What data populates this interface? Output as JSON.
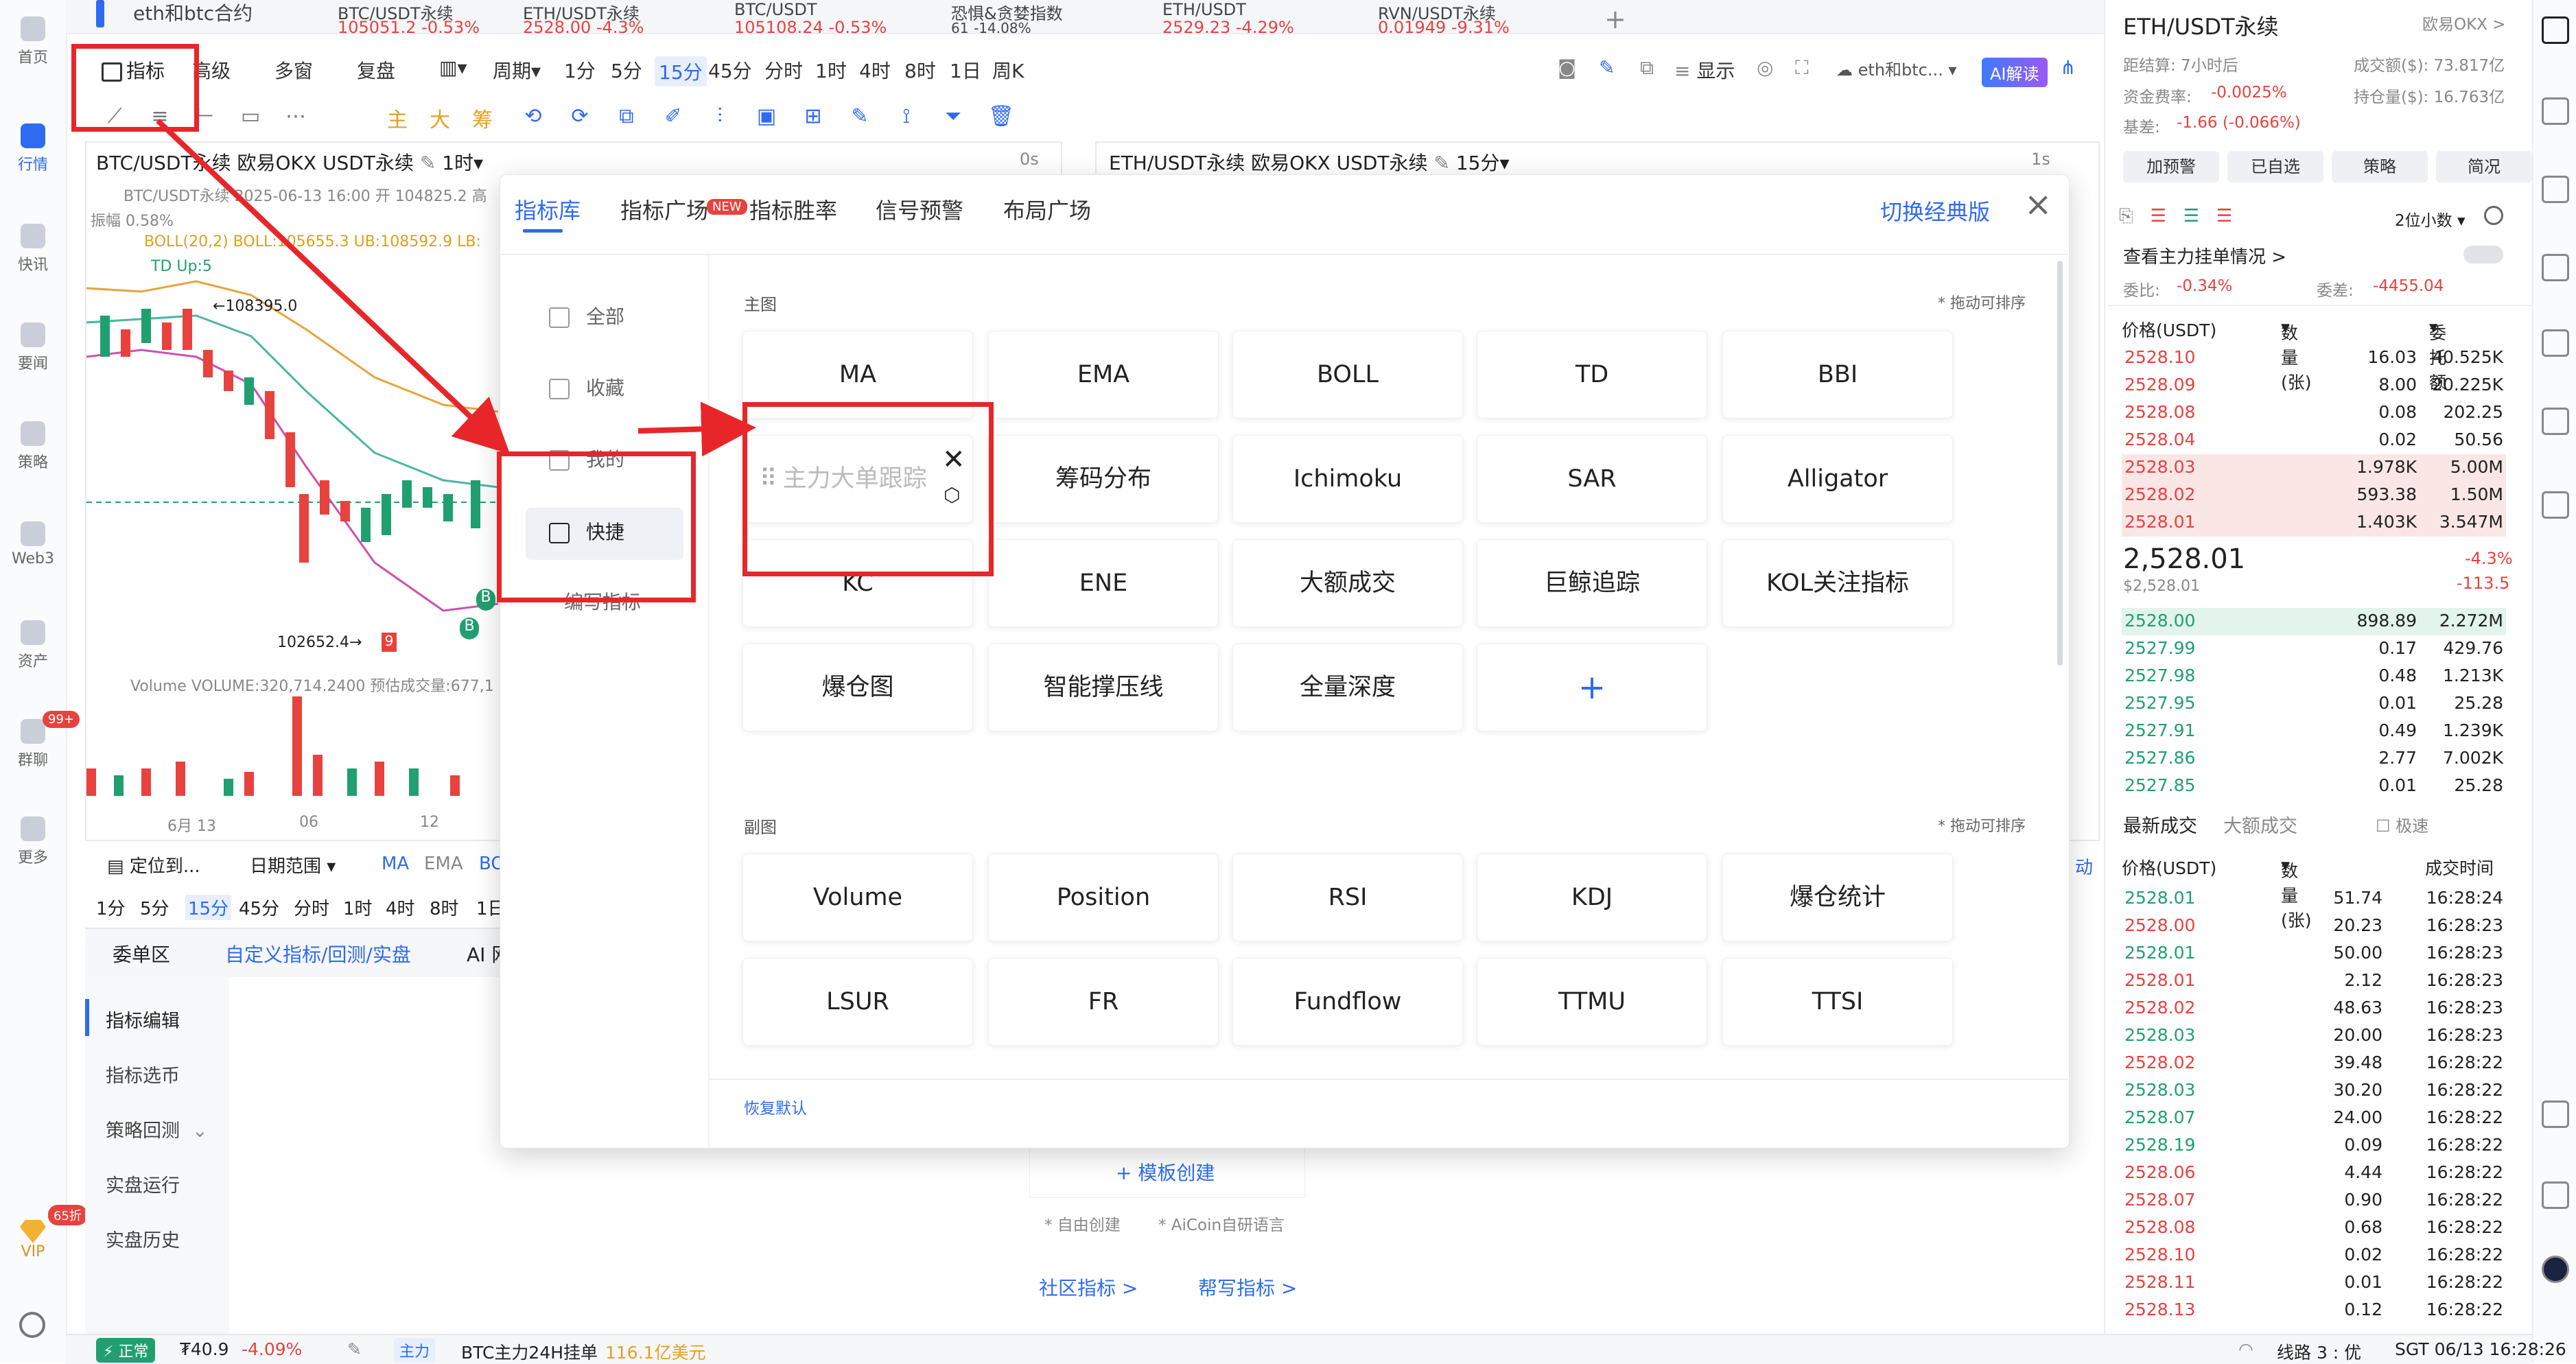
{
  "left_sidebar": [
    {
      "label": "首页",
      "icon": "home-icon"
    },
    {
      "label": "行情",
      "icon": "market-chart-icon",
      "active": true
    },
    {
      "label": "快讯",
      "icon": "news-flash-icon"
    },
    {
      "label": "要闻",
      "icon": "headline-icon"
    },
    {
      "label": "策略",
      "icon": "robot-icon"
    },
    {
      "label": "Web3",
      "icon": "web3-icon"
    },
    {
      "label": "资产",
      "icon": "wallet-icon"
    },
    {
      "label": "群聊",
      "icon": "chat-icon",
      "badge": "99+"
    },
    {
      "label": "更多",
      "icon": "grid-icon"
    }
  ],
  "vip": {
    "label": "VIP",
    "badge": "65折"
  },
  "top_tabs": [
    {
      "name": "eth和btc合约",
      "price": "",
      "change": ""
    },
    {
      "name": "BTC/USDT永续",
      "price": "105051.2",
      "change": "-0.53%"
    },
    {
      "name": "ETH/USDT永续",
      "price": "2528.00",
      "change": "-4.3%"
    },
    {
      "name": "BTC/USDT",
      "price": "105108.24",
      "change": "-0.53%"
    },
    {
      "name": "恐惧&贪婪指数",
      "price": "61",
      "change": "-14.08%"
    },
    {
      "name": "ETH/USDT",
      "price": "2529.23",
      "change": "-4.29%"
    },
    {
      "name": "RVN/USDT永续",
      "price": "0.01949",
      "change": "-9.31%"
    }
  ],
  "add_tab": "+",
  "toolbar": {
    "indicator": "指标",
    "advanced": "高级",
    "multi_window": "多窗",
    "replay": "复盘",
    "period": "周期",
    "intervals": [
      "1分",
      "5分",
      "15分",
      "45分",
      "分时",
      "1时",
      "4时",
      "8时",
      "1日",
      "周K"
    ],
    "active_interval": "15分",
    "display": "显示",
    "group": "eth和btc...",
    "ai": "AI解读"
  },
  "drawing_tools": {
    "main": "主",
    "big": "大",
    "chip": "筹"
  },
  "left_chart": {
    "title": "BTC/USDT永续 欧易OKX USDT永续",
    "period": "1时",
    "latency": "0s",
    "info_line": "BTC/USDT永续  2025-06-13 16:00  开 104825.2  高",
    "amplitude": "振幅 0.58%",
    "boll": "BOLL(20,2)  BOLL:105655.3  UB:108592.9  LB:",
    "td": "TD  Up:5",
    "high_label": "108395.0",
    "low_label": "102652.4",
    "volume": "Volume  VOLUME:320,714.2400  预估成交量:677,1",
    "dates": [
      "6月 13",
      "06",
      "12"
    ],
    "markers": [
      "9",
      "B",
      "B",
      "B"
    ]
  },
  "right_chart": {
    "title": "ETH/USDT永续 欧易OKX USDT永续",
    "period": "15分",
    "latency": "1s"
  },
  "under_chart": {
    "locate": "定位到...",
    "date_range": "日期范围",
    "ma": "MA",
    "ema": "EMA",
    "bo": "BO",
    "intervals": [
      "1分",
      "5分",
      "15分",
      "45分",
      "分时",
      "1时",
      "4时",
      "8时",
      "1日"
    ],
    "active_interval": "15分",
    "tabs": [
      "委单区",
      "自定义指标/回测/实盘",
      "AI 网"
    ],
    "side_menu": [
      "指标编辑",
      "指标选币",
      "策略回测",
      "实盘运行",
      "实盘历史"
    ],
    "template_create": "+ 模板创建",
    "free_create": "* 自由创建",
    "aicoin_lang": "* AiCoin自研语言",
    "community": "社区指标 >",
    "help": "帮写指标 >",
    "side_partial": "动"
  },
  "modal": {
    "tabs": [
      "指标库",
      "指标广场",
      "指标胜率",
      "信号预警",
      "布局广场"
    ],
    "new_badge": "NEW",
    "switch_classic": "切换经典版",
    "close": "×",
    "side": [
      "全部",
      "收藏",
      "我的",
      "快捷",
      "编写指标"
    ],
    "active_side": "快捷",
    "main_label": "主图",
    "drag_hint": "* 拖动可排序",
    "main_indicators": [
      "MA",
      "EMA",
      "BOLL",
      "TD",
      "BBI",
      "主力大单跟踪",
      "筹码分布",
      "Ichimoku",
      "SAR",
      "Alligator",
      "KC",
      "ENE",
      "大额成交",
      "巨鲸追踪",
      "KOL关注指标",
      "爆仓图",
      "智能撑压线",
      "全量深度",
      "+"
    ],
    "sub_label": "副图",
    "sub_indicators": [
      "Volume",
      "Position",
      "RSI",
      "KDJ",
      "爆仓统计",
      "LSUR",
      "FR",
      "Fundflow",
      "TTMU",
      "TTSI"
    ],
    "restore": "恢复默认"
  },
  "right_panel": {
    "symbol": "ETH/USDT永续",
    "exchange": "欧易OKX >",
    "settlement": "距结算:  7小时后",
    "volume": "成交额($): 73.817亿",
    "funding": "资金费率:",
    "funding_val": "-0.0025%",
    "oi": "持仓量($): 16.763亿",
    "basis": "基差:",
    "basis_val": "-1.66 (-0.066%)",
    "buttons": [
      "加预警",
      "已自选",
      "策略",
      "简况"
    ],
    "decimals": "2位小数",
    "main_orders": "查看主力挂单情况 >",
    "ratio_label": "委比:",
    "ratio_val": "-0.34%",
    "diff_label": "委差:",
    "diff_val": "-4455.04",
    "ob_headers": [
      "价格(USDT)",
      "数量(张)",
      "委托额"
    ],
    "asks": [
      [
        "2528.10",
        "16.03",
        "40.525K"
      ],
      [
        "2528.09",
        "8.00",
        "20.225K"
      ],
      [
        "2528.08",
        "0.08",
        "202.25"
      ],
      [
        "2528.04",
        "0.02",
        "50.56"
      ],
      [
        "2528.03",
        "1.978K",
        "5.00M"
      ],
      [
        "2528.02",
        "593.38",
        "1.50M"
      ],
      [
        "2528.01",
        "1.403K",
        "3.547M"
      ]
    ],
    "last_price": "2,528.01",
    "last_usd": "$2,528.01",
    "last_pct": "-4.3%",
    "last_chg": "-113.5",
    "bids": [
      [
        "2528.00",
        "898.89",
        "2.272M"
      ],
      [
        "2527.99",
        "0.17",
        "429.76"
      ],
      [
        "2527.98",
        "0.48",
        "1.213K"
      ],
      [
        "2527.95",
        "0.01",
        "25.28"
      ],
      [
        "2527.91",
        "0.49",
        "1.239K"
      ],
      [
        "2527.86",
        "2.77",
        "7.002K"
      ],
      [
        "2527.85",
        "0.01",
        "25.28"
      ]
    ],
    "trades_tabs": [
      "最新成交",
      "大额成交"
    ],
    "fast": "极速",
    "trade_headers": [
      "价格(USDT)",
      "数量(张)",
      "成交时间"
    ],
    "trades": [
      [
        "2528.01",
        "51.74",
        "16:28:24",
        "g"
      ],
      [
        "2528.00",
        "20.23",
        "16:28:23",
        "r"
      ],
      [
        "2528.01",
        "50.00",
        "16:28:23",
        "g"
      ],
      [
        "2528.01",
        "2.12",
        "16:28:23",
        "r"
      ],
      [
        "2528.02",
        "48.63",
        "16:28:23",
        "r"
      ],
      [
        "2528.03",
        "20.00",
        "16:28:23",
        "g"
      ],
      [
        "2528.02",
        "39.48",
        "16:28:22",
        "r"
      ],
      [
        "2528.03",
        "30.20",
        "16:28:22",
        "g"
      ],
      [
        "2528.07",
        "24.00",
        "16:28:22",
        "g"
      ],
      [
        "2528.19",
        "0.09",
        "16:28:22",
        "g"
      ],
      [
        "2528.06",
        "4.44",
        "16:28:22",
        "r"
      ],
      [
        "2528.07",
        "0.90",
        "16:28:22",
        "r"
      ],
      [
        "2528.08",
        "0.68",
        "16:28:22",
        "r"
      ],
      [
        "2528.10",
        "0.02",
        "16:28:22",
        "r"
      ],
      [
        "2528.11",
        "0.01",
        "16:28:22",
        "r"
      ],
      [
        "2528.13",
        "0.12",
        "16:28:22",
        "r"
      ]
    ]
  },
  "statusbar": {
    "status": "正常",
    "price": "₮40.9",
    "pct": "-4.09%",
    "main": "主力",
    "desc": "BTC主力24H挂单",
    "amount": "116.1亿美元",
    "line": "线路 3 : 优",
    "time": "SGT 06/13 16:28:26"
  }
}
